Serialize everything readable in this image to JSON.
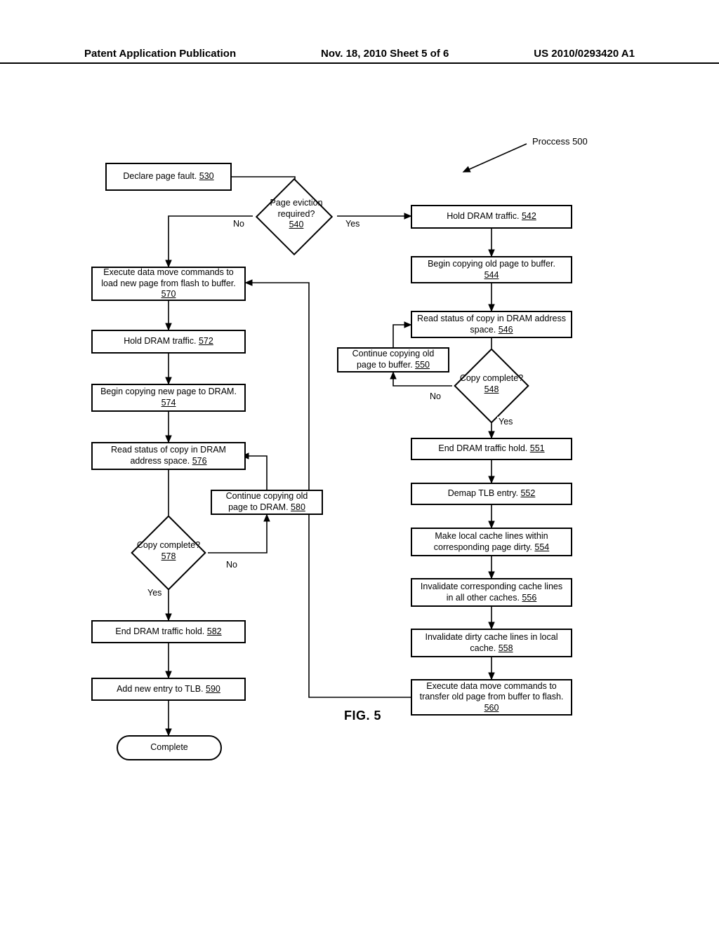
{
  "header": {
    "left": "Patent Application Publication",
    "center": "Nov. 18, 2010  Sheet 5 of 6",
    "right": "US 2010/0293420 A1"
  },
  "process_label": "Proccess 500",
  "figure_label": "FIG. 5",
  "nodes": {
    "n530": {
      "text": "Declare page fault.",
      "ref": "530"
    },
    "n540": {
      "text": "Page eviction required?",
      "ref": "540",
      "no": "No",
      "yes": "Yes"
    },
    "n542": {
      "text": "Hold DRAM traffic.",
      "ref": "542"
    },
    "n544": {
      "text": "Begin copying old page to buffer.",
      "ref": "544"
    },
    "n546": {
      "text": "Read status of copy in DRAM address space.",
      "ref": "546"
    },
    "n548": {
      "text": "Copy complete?",
      "ref": "548",
      "no": "No",
      "yes": "Yes"
    },
    "n550": {
      "text": "Continue copying old page to buffer.",
      "ref": "550"
    },
    "n551": {
      "text": "End DRAM traffic hold.",
      "ref": "551"
    },
    "n552": {
      "text": "Demap TLB entry.",
      "ref": "552"
    },
    "n554": {
      "text": "Make local cache lines within corresponding page dirty.",
      "ref": "554"
    },
    "n556": {
      "text": "Invalidate corresponding cache lines in all other caches.",
      "ref": "556"
    },
    "n558": {
      "text": "Invalidate dirty cache lines in local cache.",
      "ref": "558"
    },
    "n560": {
      "text": "Execute data move commands to transfer old page from buffer to flash.",
      "ref": "560"
    },
    "n570": {
      "text": "Execute data move commands to load new page from flash to buffer.",
      "ref": "570"
    },
    "n572": {
      "text": "Hold DRAM traffic.",
      "ref": "572"
    },
    "n574": {
      "text": "Begin copying new page to DRAM.",
      "ref": "574"
    },
    "n576": {
      "text": "Read status of copy in DRAM address space.",
      "ref": "576"
    },
    "n578": {
      "text": "Copy complete?",
      "ref": "578",
      "no": "No",
      "yes": "Yes"
    },
    "n580": {
      "text": "Continue copying old page to DRAM.",
      "ref": "580"
    },
    "n582": {
      "text": "End DRAM traffic hold.",
      "ref": "582"
    },
    "n590": {
      "text": "Add new entry to TLB.",
      "ref": "590"
    },
    "complete": {
      "text": "Complete"
    }
  }
}
